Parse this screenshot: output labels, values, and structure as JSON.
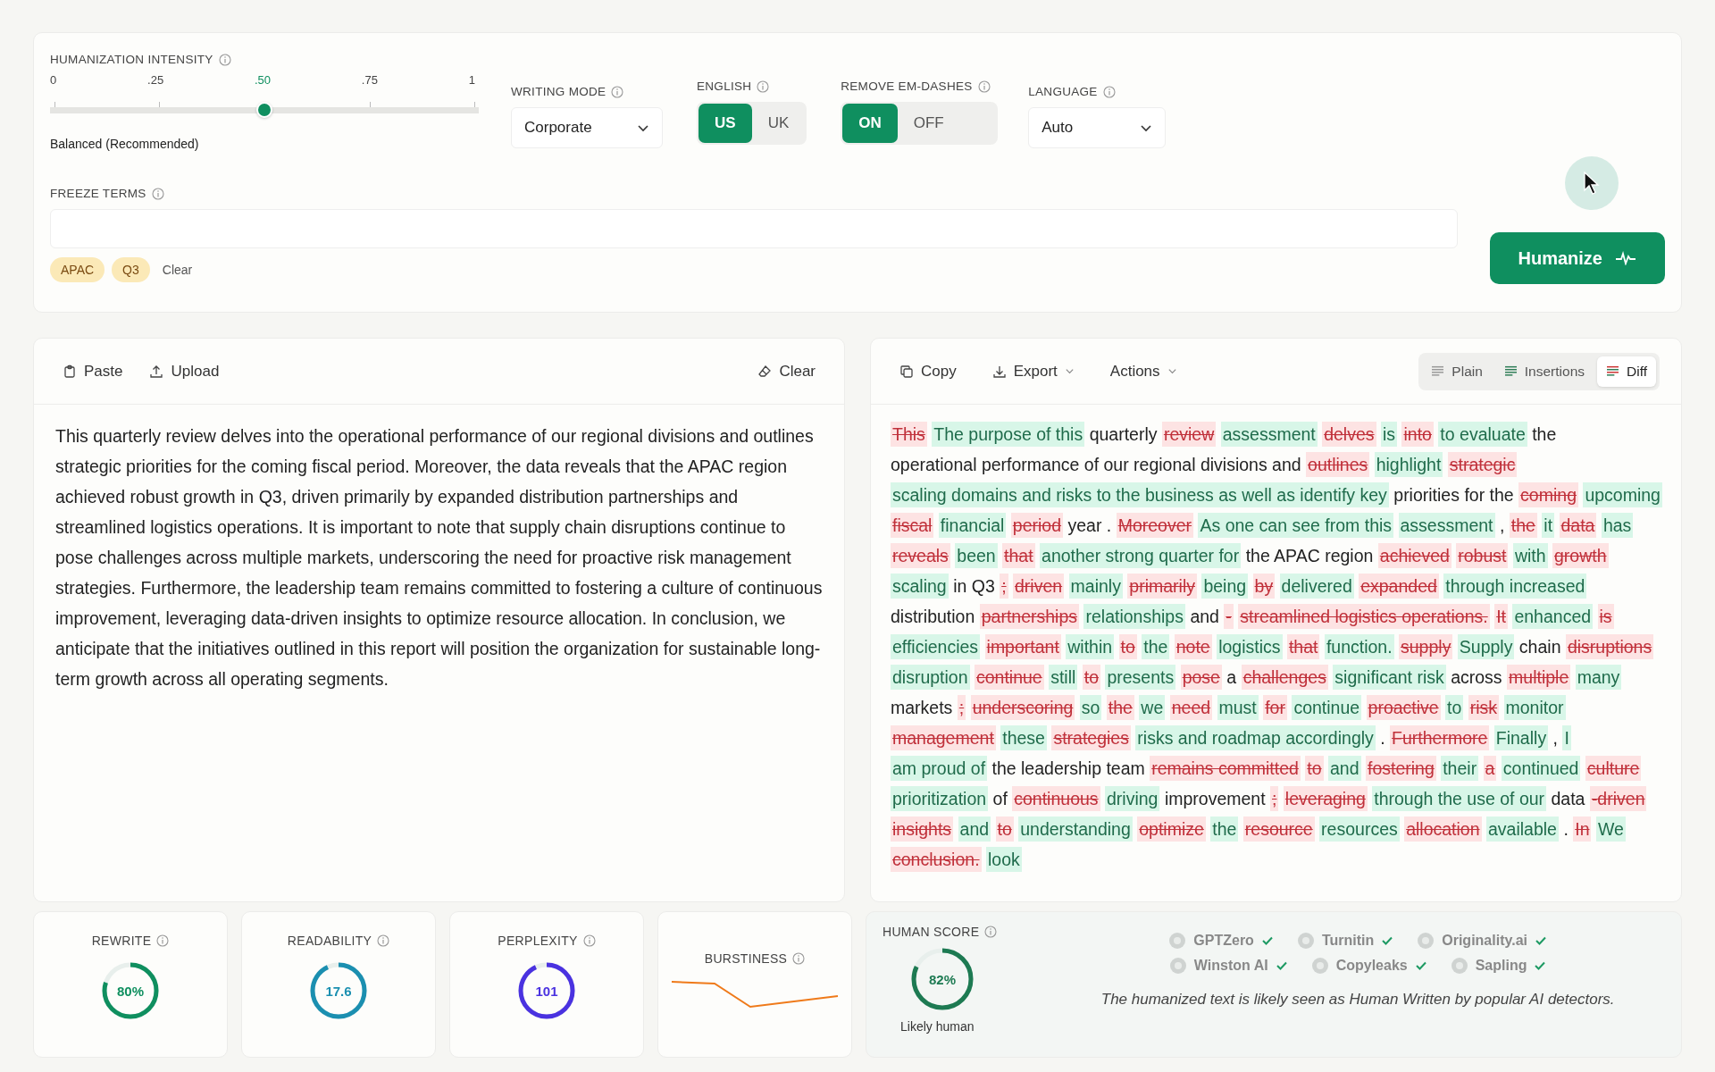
{
  "settings": {
    "intensity": {
      "label": "HUMANIZATION INTENSITY",
      "ticks": [
        {
          "label": "0",
          "selected": false
        },
        {
          "label": ".25",
          "selected": false
        },
        {
          "label": ".50",
          "selected": true
        },
        {
          "label": ".75",
          "selected": false
        },
        {
          "label": "1",
          "selected": false
        }
      ],
      "level": 0.5,
      "caption": "Balanced (Recommended)"
    },
    "writing_mode": {
      "label": "WRITING MODE",
      "value": "Corporate"
    },
    "english": {
      "label": "ENGLISH",
      "options": [
        {
          "label": "US",
          "selected": true
        },
        {
          "label": "UK",
          "selected": false
        }
      ]
    },
    "em_dashes": {
      "label": "REMOVE EM-DASHES",
      "options": [
        {
          "label": "ON",
          "selected": true
        },
        {
          "label": "OFF",
          "selected": false
        }
      ]
    },
    "language": {
      "label": "LANGUAGE",
      "value": "Auto"
    },
    "freeze_terms": {
      "label": "FREEZE TERMS",
      "chips": [
        "APAC",
        "Q3"
      ],
      "clear": "Clear"
    },
    "humanize_button": "Humanize"
  },
  "input_panel": {
    "toolbar": [
      {
        "label": "Paste",
        "kind": "paste"
      },
      {
        "label": "Upload",
        "kind": "upload"
      }
    ],
    "clear": "Clear",
    "text": "This quarterly review delves into the operational performance of our regional divisions and outlines strategic priorities for the coming fiscal period. Moreover, the data reveals that the APAC region achieved robust growth in Q3, driven primarily by expanded distribution partnerships and streamlined logistics operations. It is important to note that supply chain disruptions continue to pose challenges across multiple markets, underscoring the need for proactive risk management strategies. Furthermore, the leadership team remains committed to fostering a culture of continuous improvement, leveraging data-driven insights to optimize resource allocation. In conclusion, we anticipate that the initiatives outlined in this report will position the organization for sustainable long-term growth across all operating segments."
  },
  "output_panel": {
    "toolbar": [
      {
        "label": "Copy",
        "kind": "copy",
        "menu": false
      },
      {
        "label": "Export",
        "kind": "export",
        "menu": true
      },
      {
        "label": "Actions",
        "kind": "actions",
        "menu": true
      }
    ],
    "views": [
      {
        "label": "Plain",
        "kind": "plain",
        "selected": false
      },
      {
        "label": "Insertions",
        "kind": "insertions",
        "selected": false
      },
      {
        "label": "Diff",
        "kind": "diff",
        "selected": true
      }
    ],
    "diff": [
      {
        "kind": "del",
        "text": "This"
      },
      {
        "kind": "ins",
        "text": "The purpose of this"
      },
      {
        "kind": "keep",
        "text": "quarterly"
      },
      {
        "kind": "del",
        "text": "review"
      },
      {
        "kind": "ins",
        "text": "assessment"
      },
      {
        "kind": "del",
        "text": "delves"
      },
      {
        "kind": "ins",
        "text": "is"
      },
      {
        "kind": "del",
        "text": "into"
      },
      {
        "kind": "ins",
        "text": "to evaluate"
      },
      {
        "kind": "keep",
        "text": "the"
      },
      {
        "kind": "keep",
        "text": "operational performance of our regional divisions and"
      },
      {
        "kind": "del",
        "text": "outlines"
      },
      {
        "kind": "ins",
        "text": "highlight"
      },
      {
        "kind": "del",
        "text": "strategic"
      },
      {
        "kind": "ins",
        "text": "scaling domains and risks to the business as well as identify key"
      },
      {
        "kind": "keep",
        "text": "priorities for"
      },
      {
        "kind": "keep",
        "text": "the"
      },
      {
        "kind": "del",
        "text": "coming"
      },
      {
        "kind": "ins",
        "text": "upcoming"
      },
      {
        "kind": "del",
        "text": "fiscal"
      },
      {
        "kind": "ins",
        "text": "financial"
      },
      {
        "kind": "del",
        "text": "period"
      },
      {
        "kind": "keep",
        "text": "year"
      },
      {
        "kind": "keep",
        "text": "."
      },
      {
        "kind": "del",
        "text": "Moreover"
      },
      {
        "kind": "ins",
        "text": "As one can see from this"
      },
      {
        "kind": "ins",
        "text": "assessment"
      },
      {
        "kind": "keep",
        "text": ","
      },
      {
        "kind": "del",
        "text": "the"
      },
      {
        "kind": "ins",
        "text": "it"
      },
      {
        "kind": "del",
        "text": "data"
      },
      {
        "kind": "ins",
        "text": "has"
      },
      {
        "kind": "del",
        "text": "reveals"
      },
      {
        "kind": "ins",
        "text": "been"
      },
      {
        "kind": "del",
        "text": "that"
      },
      {
        "kind": "ins",
        "text": "another strong quarter for"
      },
      {
        "kind": "keep",
        "text": "the APAC"
      },
      {
        "kind": "keep",
        "text": "region"
      },
      {
        "kind": "del",
        "text": "achieved"
      },
      {
        "kind": "del",
        "text": "robust"
      },
      {
        "kind": "ins",
        "text": "with"
      },
      {
        "kind": "del",
        "text": "growth"
      },
      {
        "kind": "ins",
        "text": "scaling"
      },
      {
        "kind": "keep",
        "text": "in Q3"
      },
      {
        "kind": "del",
        "text": ";"
      },
      {
        "kind": "del",
        "text": "driven"
      },
      {
        "kind": "ins",
        "text": "mainly"
      },
      {
        "kind": "del",
        "text": "primarily"
      },
      {
        "kind": "ins",
        "text": "being"
      },
      {
        "kind": "del",
        "text": "by"
      },
      {
        "kind": "ins",
        "text": "delivered"
      },
      {
        "kind": "del",
        "text": "expanded"
      },
      {
        "kind": "ins",
        "text": "through increased"
      },
      {
        "kind": "keep",
        "text": "distribution"
      },
      {
        "kind": "del",
        "text": "partnerships"
      },
      {
        "kind": "ins",
        "text": "relationships"
      },
      {
        "kind": "keep",
        "text": "and"
      },
      {
        "kind": "del",
        "text": "-"
      },
      {
        "kind": "del",
        "text": "streamlined logistics operations."
      },
      {
        "kind": "del",
        "text": "It"
      },
      {
        "kind": "ins",
        "text": "enhanced"
      },
      {
        "kind": "del",
        "text": "is"
      },
      {
        "kind": "ins",
        "text": "efficiencies"
      },
      {
        "kind": "del",
        "text": "important"
      },
      {
        "kind": "ins",
        "text": "within"
      },
      {
        "kind": "del",
        "text": "to"
      },
      {
        "kind": "ins",
        "text": "the"
      },
      {
        "kind": "del",
        "text": "note"
      },
      {
        "kind": "ins",
        "text": "logistics"
      },
      {
        "kind": "del",
        "text": "that"
      },
      {
        "kind": "ins",
        "text": "function."
      },
      {
        "kind": "del",
        "text": "supply"
      },
      {
        "kind": "ins",
        "text": "Supply"
      },
      {
        "kind": "keep",
        "text": "chain"
      },
      {
        "kind": "del",
        "text": "disruptions"
      },
      {
        "kind": "ins",
        "text": "disruption"
      },
      {
        "kind": "del",
        "text": "continue"
      },
      {
        "kind": "ins",
        "text": "still"
      },
      {
        "kind": "del",
        "text": "to"
      },
      {
        "kind": "ins",
        "text": "presents"
      },
      {
        "kind": "del",
        "text": "pose"
      },
      {
        "kind": "keep",
        "text": "a"
      },
      {
        "kind": "del",
        "text": "challenges"
      },
      {
        "kind": "ins",
        "text": "significant risk"
      },
      {
        "kind": "keep",
        "text": "across"
      },
      {
        "kind": "del",
        "text": "multiple"
      },
      {
        "kind": "ins",
        "text": "many"
      },
      {
        "kind": "keep",
        "text": "markets"
      },
      {
        "kind": "del",
        "text": ";"
      },
      {
        "kind": "del",
        "text": "underscoring"
      },
      {
        "kind": "ins",
        "text": "so"
      },
      {
        "kind": "del",
        "text": "the"
      },
      {
        "kind": "ins",
        "text": "we"
      },
      {
        "kind": "del",
        "text": "need"
      },
      {
        "kind": "ins",
        "text": "must"
      },
      {
        "kind": "del",
        "text": "for"
      },
      {
        "kind": "ins",
        "text": "continue"
      },
      {
        "kind": "del",
        "text": "proactive"
      },
      {
        "kind": "ins",
        "text": "to"
      },
      {
        "kind": "del",
        "text": "risk"
      },
      {
        "kind": "ins",
        "text": "monitor"
      },
      {
        "kind": "del",
        "text": "management"
      },
      {
        "kind": "ins",
        "text": "these"
      },
      {
        "kind": "del",
        "text": "strategies"
      },
      {
        "kind": "ins",
        "text": "risks and roadmap accordingly"
      },
      {
        "kind": "keep",
        "text": "."
      },
      {
        "kind": "del",
        "text": "Furthermore"
      },
      {
        "kind": "ins",
        "text": "Finally"
      },
      {
        "kind": "keep",
        "text": ","
      },
      {
        "kind": "ins",
        "text": "I"
      },
      {
        "kind": "ins",
        "text": "am proud of"
      },
      {
        "kind": "keep",
        "text": "the leadership team"
      },
      {
        "kind": "del",
        "text": "remains committed"
      },
      {
        "kind": "del",
        "text": "to"
      },
      {
        "kind": "ins",
        "text": "and"
      },
      {
        "kind": "del",
        "text": "fostering"
      },
      {
        "kind": "ins",
        "text": "their"
      },
      {
        "kind": "del",
        "text": "a"
      },
      {
        "kind": "ins",
        "text": "continued"
      },
      {
        "kind": "del",
        "text": "culture"
      },
      {
        "kind": "ins",
        "text": "prioritization"
      },
      {
        "kind": "keep",
        "text": "of"
      },
      {
        "kind": "del",
        "text": "continuous"
      },
      {
        "kind": "ins",
        "text": "driving"
      },
      {
        "kind": "keep",
        "text": "improvement"
      },
      {
        "kind": "del",
        "text": ";"
      },
      {
        "kind": "del",
        "text": "leveraging"
      },
      {
        "kind": "ins",
        "text": "through the use of our"
      },
      {
        "kind": "keep",
        "text": "data"
      },
      {
        "kind": "del",
        "text": "-driven"
      },
      {
        "kind": "del",
        "text": "insights"
      },
      {
        "kind": "ins",
        "text": "and"
      },
      {
        "kind": "del",
        "text": "to"
      },
      {
        "kind": "ins",
        "text": "understanding"
      },
      {
        "kind": "del",
        "text": "optimize"
      },
      {
        "kind": "ins",
        "text": "the"
      },
      {
        "kind": "del",
        "text": "resource"
      },
      {
        "kind": "ins",
        "text": "resources"
      },
      {
        "kind": "del",
        "text": "allocation"
      },
      {
        "kind": "ins",
        "text": "available"
      },
      {
        "kind": "keep",
        "text": "."
      },
      {
        "kind": "del",
        "text": "In"
      },
      {
        "kind": "ins",
        "text": "We"
      },
      {
        "kind": "del",
        "text": "conclusion."
      },
      {
        "kind": "ins",
        "text": "look"
      }
    ]
  },
  "metrics": [
    {
      "label": "REWRITE",
      "kind": "ring",
      "value": "80%",
      "level": 0.8,
      "color": "#0f8f5f"
    },
    {
      "label": "READABILITY",
      "kind": "ring",
      "value": "17.6",
      "level": 0.93,
      "color": "#1b8fb0"
    },
    {
      "label": "PERPLEXITY",
      "kind": "ring",
      "value": "101",
      "level": 0.93,
      "color": "#4a32e0"
    },
    {
      "label": "BURSTINESS",
      "kind": "sparkline"
    }
  ],
  "human_score": {
    "label": "HUMAN SCORE",
    "value": "82%",
    "level": 0.82,
    "verdict": "Likely human",
    "detectors": [
      {
        "name": "GPTZero",
        "passed": true
      },
      {
        "name": "Turnitin",
        "passed": true
      },
      {
        "name": "Originality.ai",
        "passed": true
      },
      {
        "name": "Winston AI",
        "passed": true
      },
      {
        "name": "Copyleaks",
        "passed": true
      },
      {
        "name": "Sapling",
        "passed": true
      }
    ],
    "note": "The humanized text is likely seen as Human Written by popular AI detectors."
  }
}
